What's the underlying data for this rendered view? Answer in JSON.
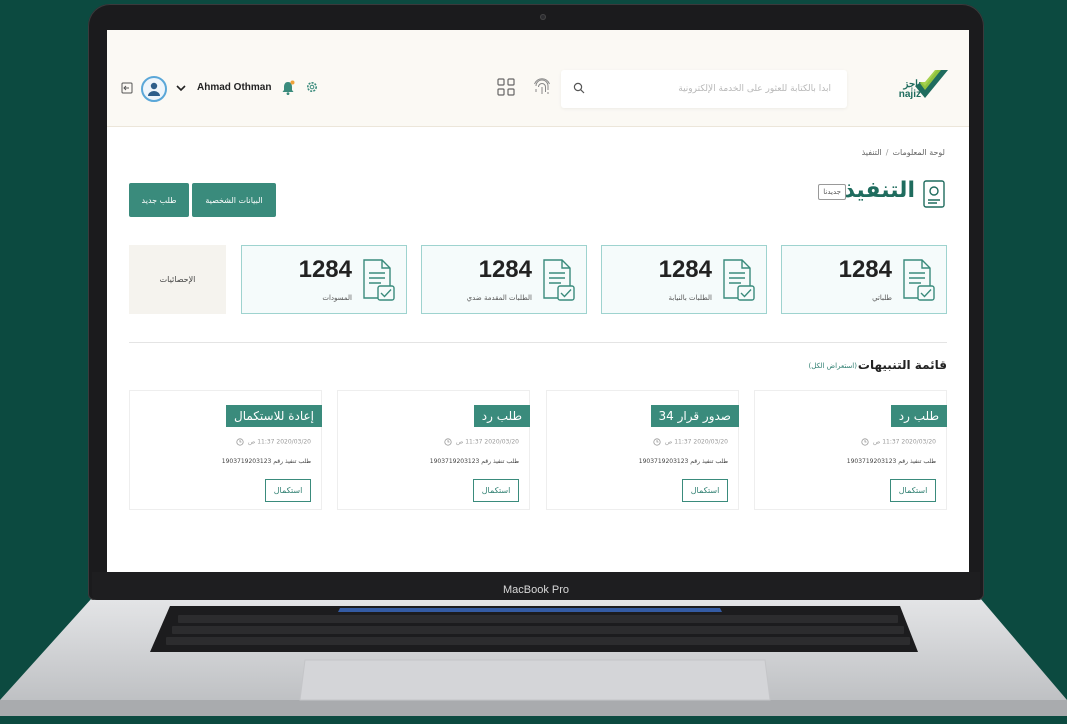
{
  "device": {
    "label": "MacBook Pro"
  },
  "header": {
    "logo_text_ar": "ناجز",
    "logo_text_en": "najiz",
    "search_placeholder": "ابدأ بالكتابة للعثور على الخدمة الإلكترونية",
    "username": "Ahmad Othman"
  },
  "breadcrumb": {
    "home": "لوحة المعلومات",
    "separator": "/",
    "current": "التنفيذ"
  },
  "page": {
    "title": "التنفيذ",
    "badge": "جديدنا",
    "buttons": {
      "new_request": "طلب جديد",
      "personal_data": "البيانات الشخصية"
    }
  },
  "stats": {
    "statistics_label": "الإحصائيات",
    "cards": [
      {
        "number": "1284",
        "label": "طلباتي"
      },
      {
        "number": "1284",
        "label": "الطلبات بالنيابة"
      },
      {
        "number": "1284",
        "label": "الطلبات المقدمة ضدي"
      },
      {
        "number": "1284",
        "label": "المسودات"
      }
    ]
  },
  "alerts": {
    "title": "قائمة التنبيهات",
    "view_all": "(استعراض الكل)",
    "items": [
      {
        "tag": "طلب رد",
        "time": "2020/03/20 11:37 ص",
        "desc": "طلب تنفيذ رقم 1903719203123",
        "button": "استكمال"
      },
      {
        "tag": "صدور قرار 34",
        "time": "2020/03/20 11:37 ص",
        "desc": "طلب تنفيذ رقم 1903719203123",
        "button": "استكمال"
      },
      {
        "tag": "طلب رد",
        "time": "2020/03/20 11:37 ص",
        "desc": "طلب تنفيذ رقم 1903719203123",
        "button": "استكمال"
      },
      {
        "tag": "إعادة للاستكمال",
        "time": "2020/03/20 11:37 ص",
        "desc": "طلب تنفيذ رقم 1903719203123",
        "button": "استكمال"
      }
    ]
  },
  "colors": {
    "brand_green": "#3a8b7c",
    "logo_dark": "#1f6c5e",
    "logo_light": "#9ccc3c",
    "background": "#0c4a40"
  }
}
